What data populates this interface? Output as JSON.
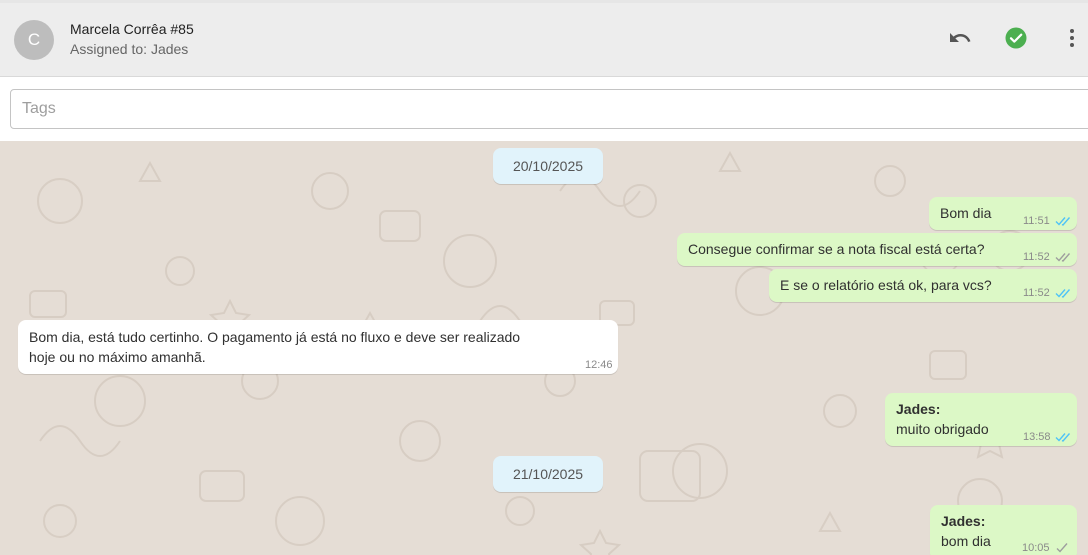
{
  "header": {
    "avatar_letter": "C",
    "contact_name": "Marcela Corrêa #85",
    "assigned_to": "Assigned to: Jades",
    "icons": [
      "undo-icon",
      "resolve-check-icon",
      "more-vert-icon"
    ],
    "accent_color": "#4caf50"
  },
  "tags": {
    "placeholder": "Tags",
    "value": ""
  },
  "messages": {
    "date1": "20/10/2025",
    "m1": {
      "text": "Bom dia",
      "time": "11:51"
    },
    "m2": {
      "text": "Consegue confirmar se a nota fiscal está certa?",
      "time": "11:52"
    },
    "m3": {
      "text": "E se o relatório está ok, para vcs?",
      "time": "11:52"
    },
    "m4": {
      "line1": "Bom dia, está tudo certinho. O pagamento já está no fluxo e deve ser realizado",
      "line2": "hoje ou no máximo amanhã.",
      "time": "12:46"
    },
    "m5": {
      "sender": "Jades:",
      "text": "muito obrigado",
      "time": "13:58"
    },
    "date2": "21/10/2025",
    "m6": {
      "sender": "Jades:",
      "text": "bom dia",
      "time": "10:05"
    }
  },
  "colors": {
    "chat_background": "#e5ddd5",
    "outgoing_bubble": "#dcf8c6",
    "incoming_bubble": "#ffffff",
    "date_chip": "#e1f3fb"
  }
}
